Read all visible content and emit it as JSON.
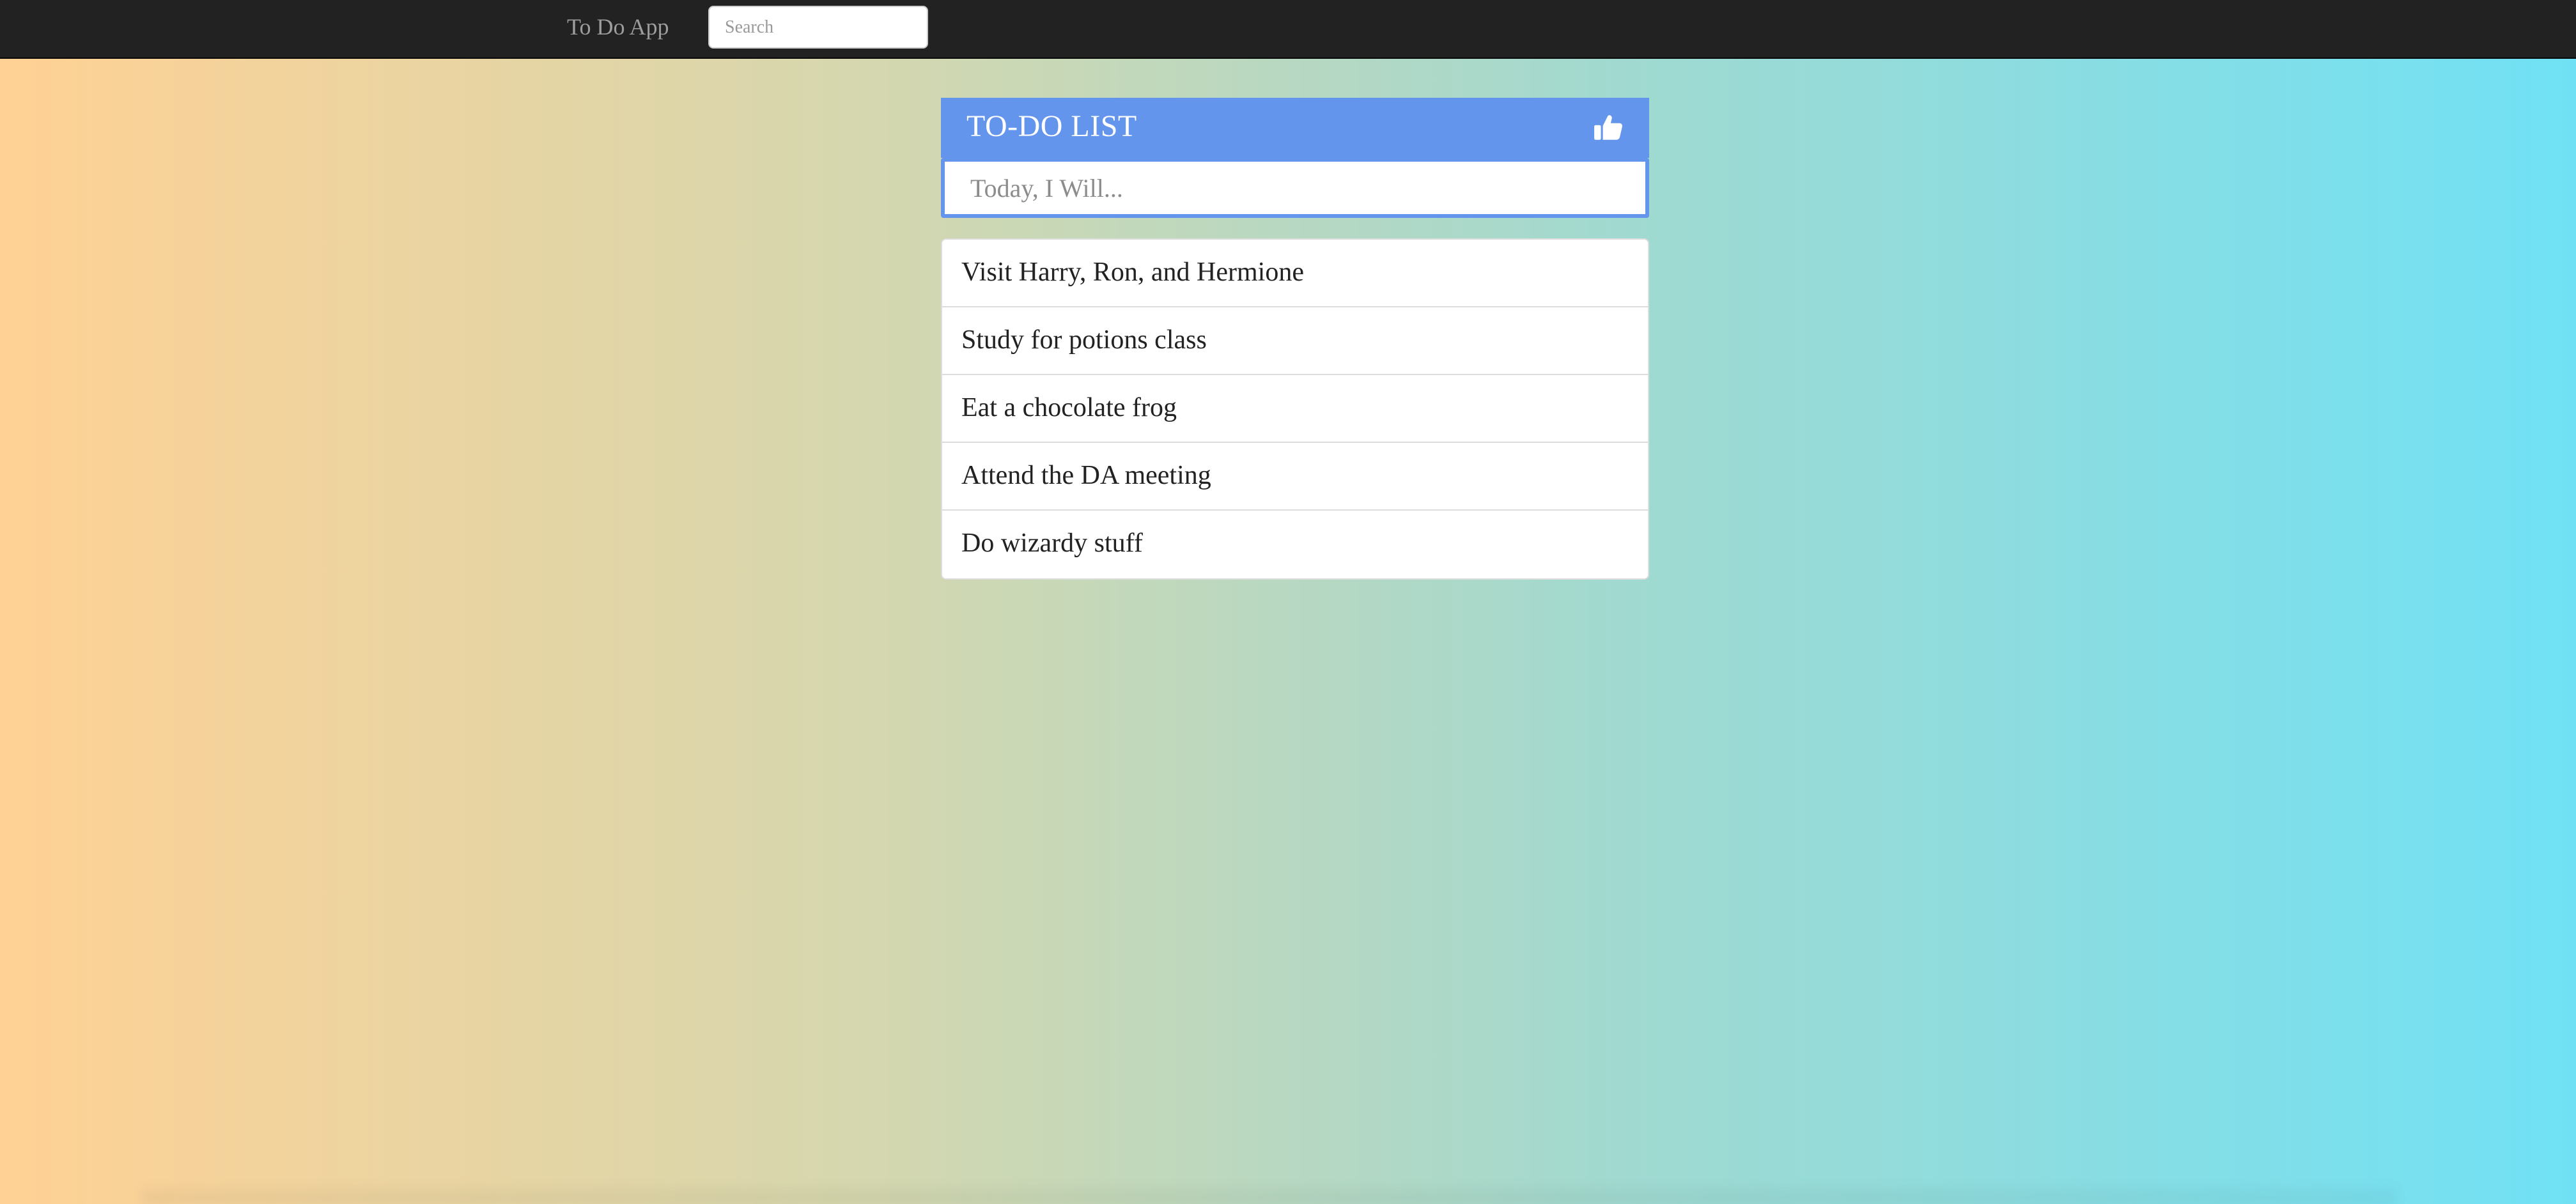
{
  "navbar": {
    "brand": "To Do App",
    "search_placeholder": "Search"
  },
  "todo": {
    "title": "TO-DO LIST",
    "header_icon": "thumbs-up-icon",
    "input_placeholder": "Today, I Will...",
    "items": [
      {
        "label": "Visit Harry, Ron, and Hermione"
      },
      {
        "label": "Study for potions class"
      },
      {
        "label": "Eat a chocolate frog"
      },
      {
        "label": "Attend the DA meeting"
      },
      {
        "label": "Do wizardy stuff"
      }
    ]
  },
  "colors": {
    "navbar_bg": "#222222",
    "header_bg": "#6495ed",
    "gradient_start": "#ffd194",
    "gradient_end": "#70e1f5"
  }
}
